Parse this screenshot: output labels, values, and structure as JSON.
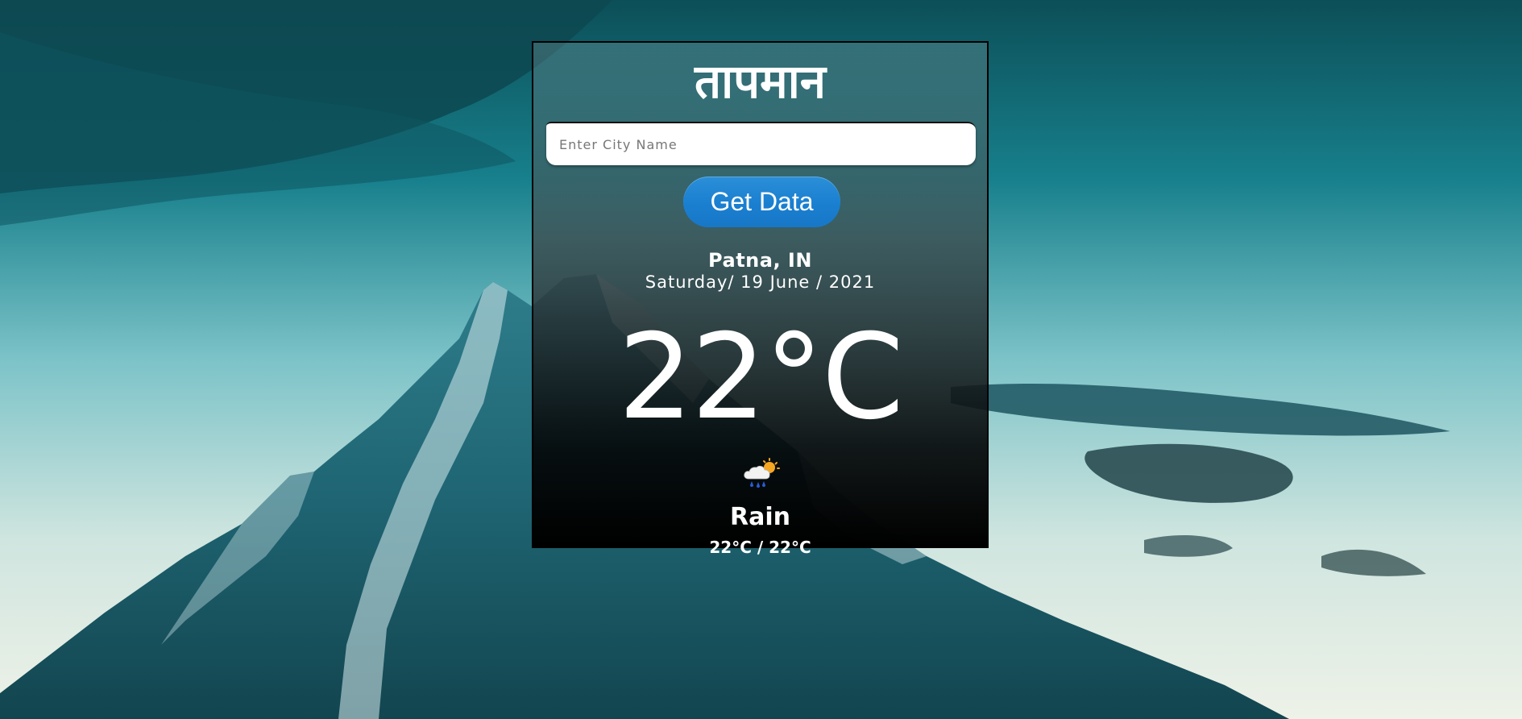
{
  "app": {
    "title": "तापमान"
  },
  "search": {
    "placeholder": "Enter City Name",
    "value": ""
  },
  "actions": {
    "get_data_label": "Get Data"
  },
  "weather": {
    "location": "Patna, IN",
    "date": "Saturday/ 19 June / 2021",
    "temperature": "22°C",
    "icon": "rain-sun-cloud-icon",
    "condition": "Rain",
    "min_max": "22°C / 22°C"
  },
  "colors": {
    "button": "#1a7fd0",
    "card_border": "#000000",
    "text": "#ffffff"
  }
}
